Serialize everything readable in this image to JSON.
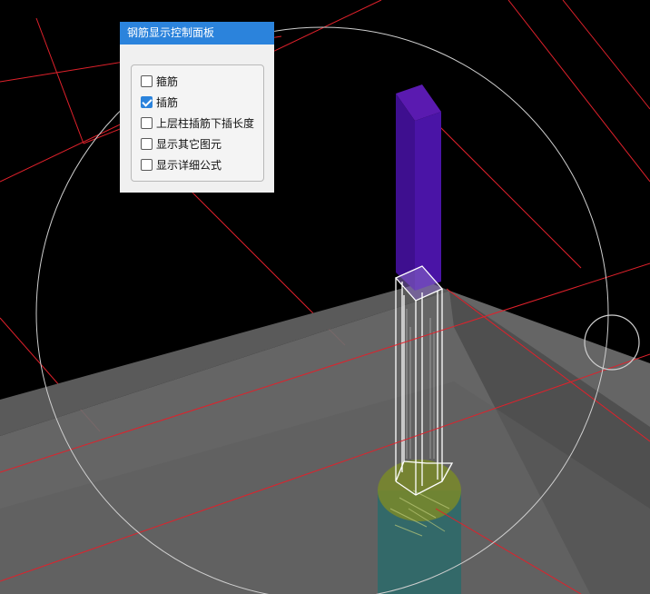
{
  "panel": {
    "title": "钢筋显示控制面板",
    "options": [
      {
        "label": "箍筋",
        "checked": false
      },
      {
        "label": "插筋",
        "checked": true
      },
      {
        "label": "上层柱插筋下插长度",
        "checked": false
      },
      {
        "label": "显示其它图元",
        "checked": false
      },
      {
        "label": "显示详细公式",
        "checked": false
      }
    ]
  },
  "scene": {
    "colors": {
      "background": "#000000",
      "slab": "#6b6b6b",
      "upper_column": "#3e0f8f",
      "lower_column_base": "#2f6a6a",
      "lower_column_top": "#7a8a2a",
      "axis_lines": "#e0212b",
      "wireframe": "#ffffff",
      "orbit_circle": "#cfcfcf"
    }
  }
}
